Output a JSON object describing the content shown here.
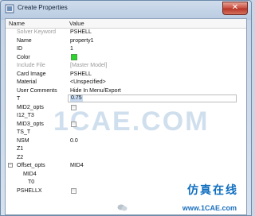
{
  "window": {
    "title": "Create Properties",
    "close_symbol": "✕"
  },
  "table": {
    "headers": {
      "name": "Name",
      "value": "Value"
    },
    "rows": [
      {
        "label": "Solver Keyword",
        "value": "PSHELL",
        "label_muted": true
      },
      {
        "label": "Name",
        "value": "property1"
      },
      {
        "label": "ID",
        "value": "1"
      },
      {
        "label": "Color",
        "value": "",
        "color": "#2bd52b"
      },
      {
        "label": "Include File",
        "value": "[Master Model]",
        "label_muted": true,
        "value_muted": true
      },
      {
        "label": "Card Image",
        "value": "PSHELL"
      },
      {
        "label": "Material",
        "value": "<Unspecified>"
      },
      {
        "label": "User Comments",
        "value": "Hide In Menu/Export"
      },
      {
        "label": "T",
        "value": "0.75",
        "editing": true
      },
      {
        "label": "MID2_opts",
        "value": "",
        "checkbox": true
      },
      {
        "label": "I12_T3",
        "value": ""
      },
      {
        "label": "MID3_opts",
        "value": "",
        "checkbox": true
      },
      {
        "label": "TS_T",
        "value": ""
      },
      {
        "label": "NSM",
        "value": "0.0"
      },
      {
        "label": "Z1",
        "value": ""
      },
      {
        "label": "Z2",
        "value": ""
      },
      {
        "label": "Offset_opts",
        "value": "MID4",
        "expandable": true
      },
      {
        "label": "MID4",
        "value": ""
      },
      {
        "label": "T0",
        "value": ""
      },
      {
        "label": "PSHELLX",
        "value": "",
        "checkbox": true
      }
    ]
  },
  "watermark": {
    "text": "1CAE.COM"
  },
  "branding": {
    "chinese": "仿真在线",
    "url": "www.1CAE.com"
  }
}
